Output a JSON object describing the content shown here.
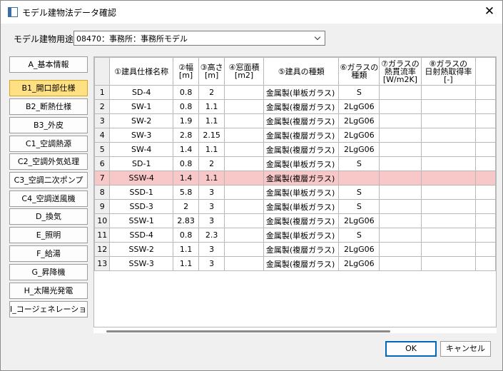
{
  "window": {
    "title": "モデル建物法データ確認"
  },
  "usage": {
    "label": "モデル建物用途",
    "selected": "08470：事務所：事務所モデル"
  },
  "sidebar": {
    "items": [
      {
        "label": "A_基本情報"
      },
      {
        "label": "B1_開口部仕様"
      },
      {
        "label": "B2_断熱仕様"
      },
      {
        "label": "B3_外皮"
      },
      {
        "label": "C1_空調熱源"
      },
      {
        "label": "C2_空調外気処理"
      },
      {
        "label": "C3_空調二次ポンプ"
      },
      {
        "label": "C4_空調送風機"
      },
      {
        "label": "D_換気"
      },
      {
        "label": "E_照明"
      },
      {
        "label": "F_給湯"
      },
      {
        "label": "G_昇降機"
      },
      {
        "label": "H_太陽光発電"
      },
      {
        "label": "I_コージェネレーション"
      }
    ],
    "active_index": 1
  },
  "grid": {
    "columns": [
      {
        "line1": "①建具仕様名称",
        "line2": ""
      },
      {
        "line1": "②幅",
        "line2": "[m]"
      },
      {
        "line1": "③高さ",
        "line2": "[m]"
      },
      {
        "line1": "④窓面積",
        "line2": "[m2]"
      },
      {
        "line1": "⑤建具の種類",
        "line2": ""
      },
      {
        "line1": "⑥ガラスの",
        "line2": "種類"
      },
      {
        "line1": "⑦ガラスの",
        "line2": "熱貫流率",
        "line3": "[W/m2K]"
      },
      {
        "line1": "⑧ガラスの",
        "line2": "日射熱取得率",
        "line3": "[-]"
      }
    ],
    "rows": [
      {
        "n": "1",
        "name": "SD-4",
        "w": "0.8",
        "h": "2",
        "area": "",
        "type": "金属製(単板ガラス)",
        "glass": "S"
      },
      {
        "n": "2",
        "name": "SW-1",
        "w": "0.8",
        "h": "1.1",
        "area": "",
        "type": "金属製(複層ガラス)",
        "glass": "2LgG06"
      },
      {
        "n": "3",
        "name": "SW-2",
        "w": "1.9",
        "h": "1.1",
        "area": "",
        "type": "金属製(複層ガラス)",
        "glass": "2LgG06"
      },
      {
        "n": "4",
        "name": "SW-3",
        "w": "2.8",
        "h": "2.15",
        "area": "",
        "type": "金属製(複層ガラス)",
        "glass": "2LgG06"
      },
      {
        "n": "5",
        "name": "SW-4",
        "w": "1.4",
        "h": "1.1",
        "area": "",
        "type": "金属製(複層ガラス)",
        "glass": "2LgG06"
      },
      {
        "n": "6",
        "name": "SD-1",
        "w": "0.8",
        "h": "2",
        "area": "",
        "type": "金属製(単板ガラス)",
        "glass": "S"
      },
      {
        "n": "7",
        "name": "SSW-4",
        "w": "1.4",
        "h": "1.1",
        "area": "",
        "type": "金属製(複層ガラス)",
        "glass": ""
      },
      {
        "n": "8",
        "name": "SSD-1",
        "w": "5.8",
        "h": "3",
        "area": "",
        "type": "金属製(単板ガラス)",
        "glass": "S"
      },
      {
        "n": "9",
        "name": "SSD-3",
        "w": "2",
        "h": "3",
        "area": "",
        "type": "金属製(単板ガラス)",
        "glass": "S"
      },
      {
        "n": "10",
        "name": "SSW-1",
        "w": "2.83",
        "h": "3",
        "area": "",
        "type": "金属製(複層ガラス)",
        "glass": "2LgG06"
      },
      {
        "n": "11",
        "name": "SSD-4",
        "w": "0.8",
        "h": "2.3",
        "area": "",
        "type": "金属製(単板ガラス)",
        "glass": "S"
      },
      {
        "n": "12",
        "name": "SSW-2",
        "w": "1.1",
        "h": "3",
        "area": "",
        "type": "金属製(複層ガラス)",
        "glass": "2LgG06"
      },
      {
        "n": "13",
        "name": "SSW-3",
        "w": "1.1",
        "h": "3",
        "area": "",
        "type": "金属製(複層ガラス)",
        "glass": "2LgG06"
      }
    ],
    "selected_row_index": 6
  },
  "buttons": {
    "ok": "OK",
    "cancel": "キャンセル"
  },
  "colors": {
    "active_tab": "#ffe082",
    "selected_row": "#f8c8c8",
    "ok_border": "#0067c0"
  }
}
